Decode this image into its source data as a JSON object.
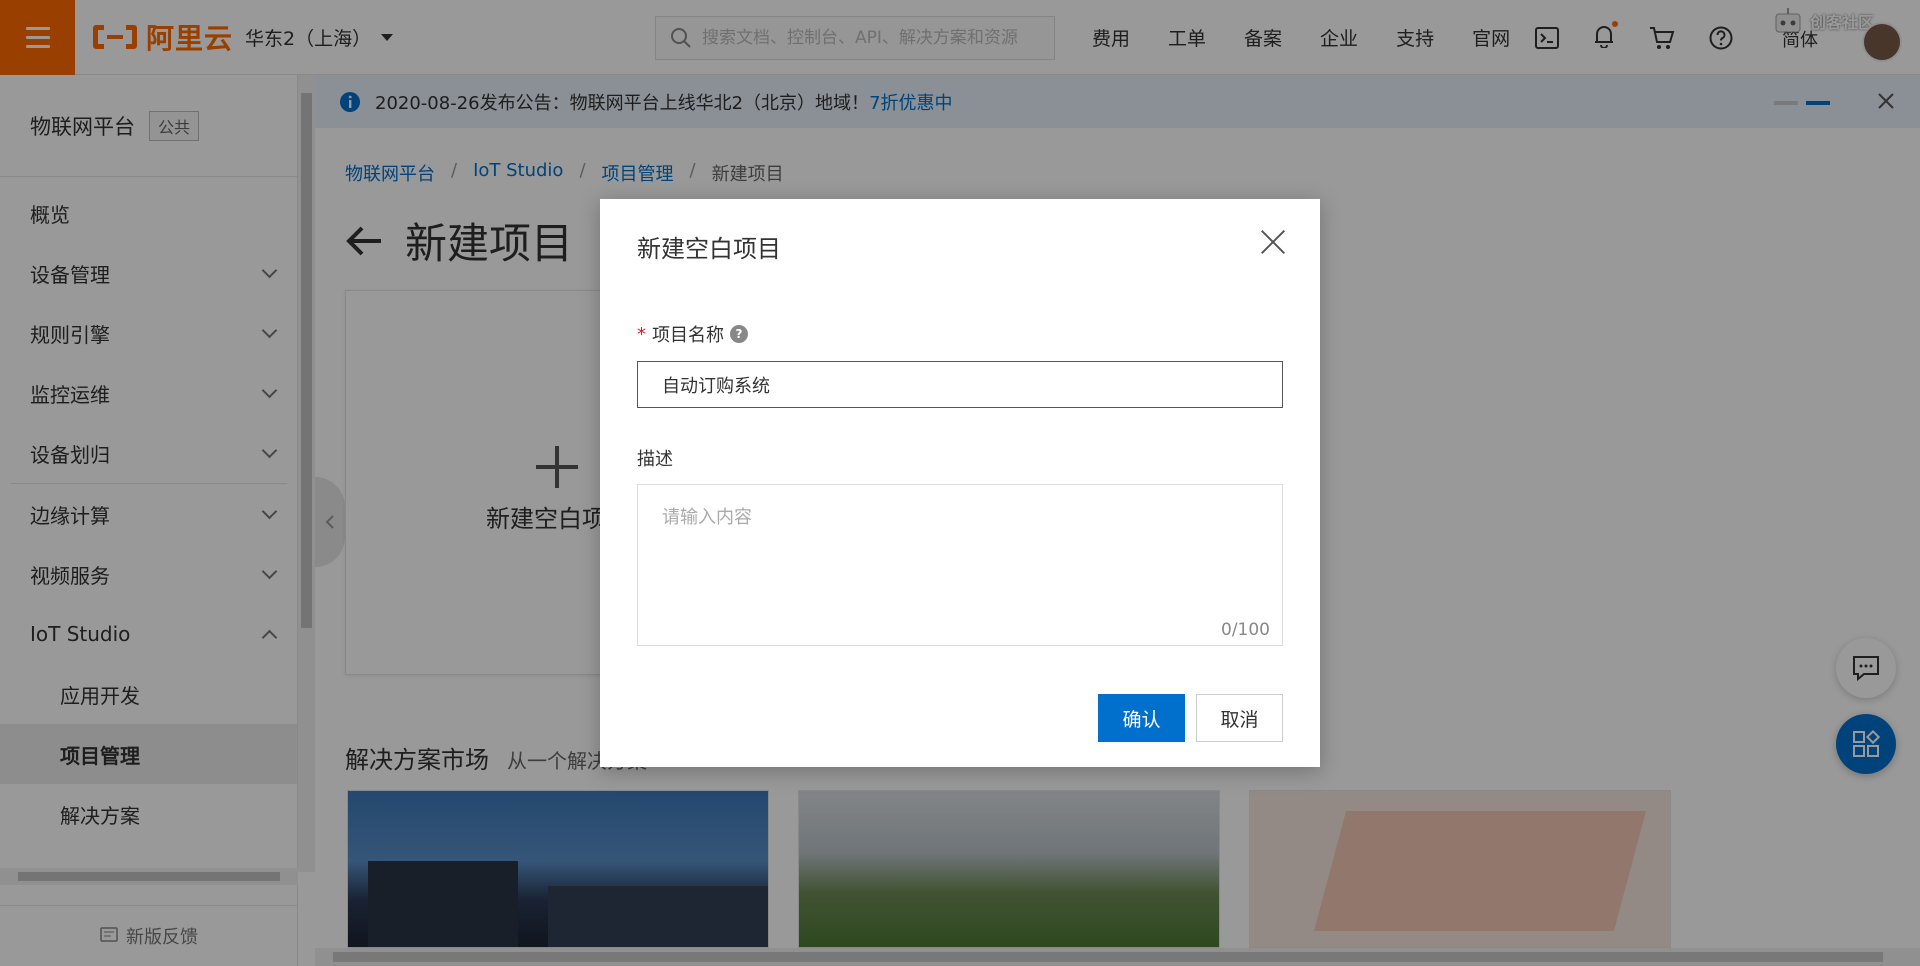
{
  "header": {
    "logo_text": "阿里云",
    "region": "华东2（上海）",
    "search_placeholder": "搜索文档、控制台、API、解决方案和资源",
    "nav_links": [
      "费用",
      "工单",
      "备案",
      "企业",
      "支持",
      "官网"
    ],
    "lang": "简体",
    "watermark": "创客社区",
    "brand_color": "#ff6a00"
  },
  "sidebar": {
    "title": "物联网平台",
    "badge": "公共",
    "items": [
      {
        "label": "概览"
      },
      {
        "label": "设备管理"
      },
      {
        "label": "规则引擎"
      },
      {
        "label": "监控运维"
      },
      {
        "label": "设备划归"
      },
      {
        "label": "边缘计算"
      },
      {
        "label": "视频服务"
      },
      {
        "label": "IoT Studio"
      },
      {
        "label": "应用开发"
      },
      {
        "label": "项目管理"
      },
      {
        "label": "解决方案"
      }
    ],
    "feedback": "新版反馈"
  },
  "notice": {
    "text": "2020-08-26发布公告：物联网平台上线华北2（北京）地域！",
    "link": "7折优惠中"
  },
  "breadcrumb": {
    "items": [
      "物联网平台",
      "IoT Studio",
      "项目管理",
      "新建项目"
    ]
  },
  "page": {
    "title": "新建项目",
    "new_card_label": "新建空白项目",
    "market_title": "解决方案市场",
    "market_sub": "从一个解决方案"
  },
  "dialog": {
    "title": "新建空白项目",
    "name_label": "项目名称",
    "name_value": "自动订购系统",
    "desc_label": "描述",
    "desc_placeholder": "请输入内容",
    "counter": "0/100",
    "confirm": "确认",
    "cancel": "取消",
    "accent_color": "#0070cc"
  }
}
